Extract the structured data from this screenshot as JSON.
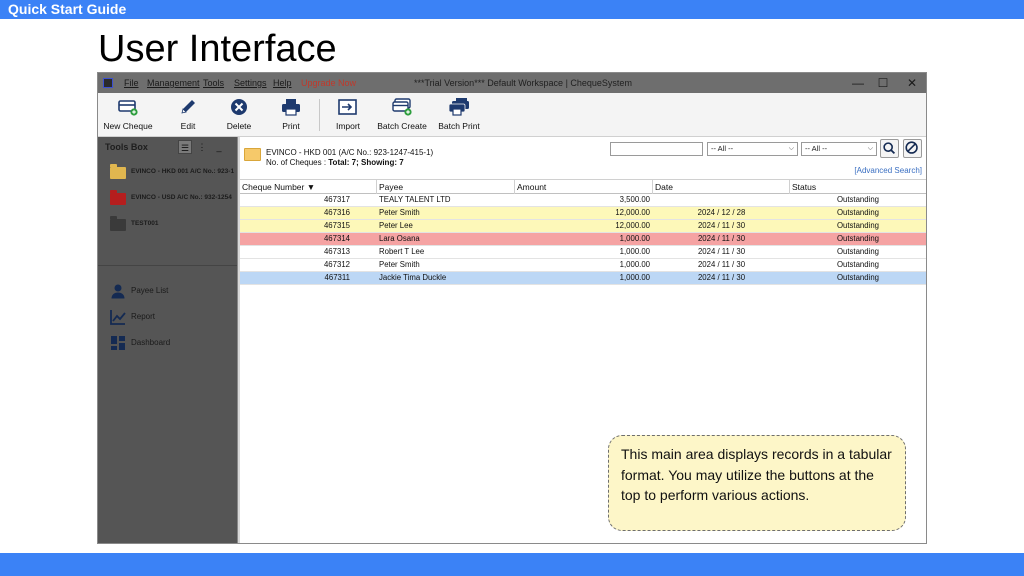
{
  "slide": {
    "header_label": "Quick Start Guide",
    "title": "User Interface",
    "callout": "This main area displays records in a tabular format. You may utilize the buttons at the top to perform various actions."
  },
  "colors": {
    "slide_bar": "#3b82f6",
    "row_yellow": "#fdf8b9",
    "row_red": "#f5a3a3",
    "row_blue": "#bcd7f5",
    "upgrade": "#c0392b"
  },
  "window": {
    "title": "***Trial Version*** Default Workspace | ChequeSystem",
    "menu": [
      "File",
      "Management",
      "Tools",
      "Settings",
      "Help"
    ],
    "upgrade": "Upgrade Now",
    "controls": {
      "minimize": "—",
      "maximize": "☐",
      "close": "✕"
    }
  },
  "toolbar": {
    "new_cheque": "New Cheque",
    "edit": "Edit",
    "delete": "Delete",
    "print": "Print",
    "import": "Import",
    "batch_create": "Batch Create",
    "batch_print": "Batch Print"
  },
  "sidebar": {
    "title": "Tools Box",
    "accounts": [
      {
        "label": "EVINCO - HKD 001 A/C No.: 923-1",
        "color": "#e0b64f"
      },
      {
        "label": "EVINCO - USD A/C No.: 932-1254",
        "color": "#b51e1e"
      },
      {
        "label": "TEST001",
        "color": "#3a3a3a"
      }
    ],
    "nav": [
      "Payee List",
      "Report",
      "Dashboard"
    ]
  },
  "main": {
    "account_title": "EVINCO - HKD 001 (A/C No.: 923-1247-415-1)",
    "count_prefix": "No. of Cheques : ",
    "count_value": "Total: 7; Showing: 7",
    "search_value": "",
    "filter1": "-- All --",
    "filter2": "-- All --",
    "advanced_search": "[Advanced Search]"
  },
  "table": {
    "columns": [
      "Cheque Number ▼",
      "Payee",
      "Amount",
      "Date",
      "Status"
    ],
    "rows": [
      {
        "number": "467317",
        "payee": "TEALY TALENT LTD",
        "amount": "3,500.00",
        "date": "",
        "status": "Outstanding",
        "tone": "white"
      },
      {
        "number": "467316",
        "payee": "Peter Smith",
        "amount": "12,000.00",
        "date": "2024 / 12 / 28",
        "status": "Outstanding",
        "tone": "yellow"
      },
      {
        "number": "467315",
        "payee": "Peter Lee",
        "amount": "12,000.00",
        "date": "2024 / 11 / 30",
        "status": "Outstanding",
        "tone": "yellow"
      },
      {
        "number": "467314",
        "payee": "Lara Osana",
        "amount": "1,000.00",
        "date": "2024 / 11 / 30",
        "status": "Outstanding",
        "tone": "red"
      },
      {
        "number": "467313",
        "payee": "Robert T Lee",
        "amount": "1,000.00",
        "date": "2024 / 11 / 30",
        "status": "Outstanding",
        "tone": "white"
      },
      {
        "number": "467312",
        "payee": "Peter Smith",
        "amount": "1,000.00",
        "date": "2024 / 11 / 30",
        "status": "Outstanding",
        "tone": "white"
      },
      {
        "number": "467311",
        "payee": "Jackie Tima Duckle",
        "amount": "1,000.00",
        "date": "2024 / 11 / 30",
        "status": "Outstanding",
        "tone": "blue"
      }
    ]
  }
}
